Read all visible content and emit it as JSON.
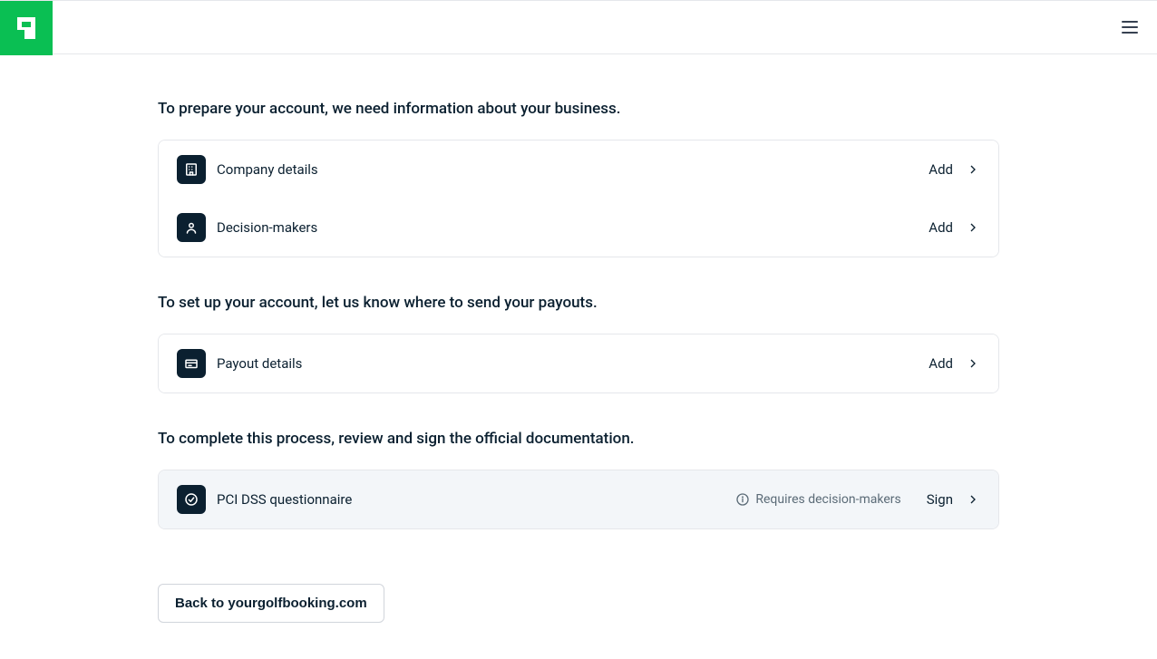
{
  "sections": [
    {
      "heading": "To prepare your account, we need information about your business.",
      "rows": [
        {
          "label": "Company details",
          "action": "Add",
          "marker": "✗"
        },
        {
          "label": "Decision-makers",
          "action": "Add",
          "marker": "✗"
        }
      ]
    },
    {
      "heading": "To set up your account, let us know where to send your payouts.",
      "rows": [
        {
          "label": "Payout details",
          "action": "Add",
          "marker": "✗"
        }
      ]
    },
    {
      "heading": "To complete this process, review and sign the official documentation.",
      "rows": [
        {
          "label": "PCI DSS questionnaire",
          "action": "Sign",
          "note": "Requires decision-makers",
          "marker": "✗",
          "disabled": true
        }
      ]
    }
  ],
  "back_button": "Back to yourgolfbooking.com"
}
